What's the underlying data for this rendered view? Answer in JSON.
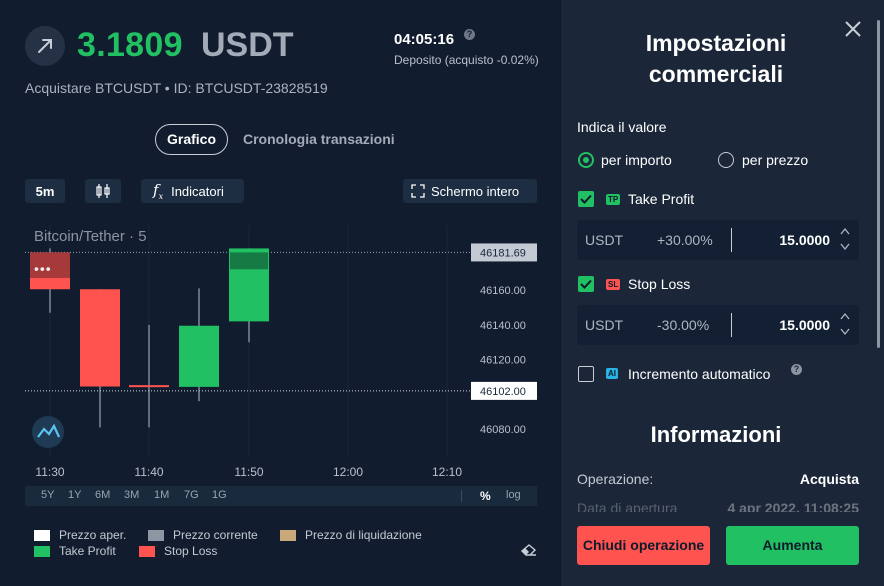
{
  "header": {
    "price": "3.1809",
    "currency": "USDT",
    "timer": "04:05:16",
    "deposit_label": "Deposito (acquisto -0.02%)",
    "subtitle": "Acquistare BTCUSDT • ID: BTCUSDT-23828519"
  },
  "tabs": {
    "chart": "Grafico",
    "history": "Cronologia transazioni"
  },
  "toolbar": {
    "interval": "5m",
    "indicators": "Indicatori",
    "fullscreen": "Schermo intero"
  },
  "chart_data": {
    "type": "candlestick",
    "title": "Bitcoin/Tether · 5",
    "x_ticks": [
      "11:30",
      "11:40",
      "11:50",
      "12:00",
      "12:10"
    ],
    "y_ticks": [
      "46160.00",
      "46140.00",
      "46120.00",
      "46080.00"
    ],
    "price_labels": {
      "upper": "46181.69",
      "current": "46102.00"
    },
    "ylim": [
      46072,
      46190
    ],
    "candles": [
      {
        "time": "11:30",
        "open": 46181.7,
        "close": 46160.5,
        "high": 46184,
        "low": 46147,
        "color": "red"
      },
      {
        "time": "11:35",
        "open": 46160.5,
        "close": 46104.5,
        "high": 46160.5,
        "low": 46081,
        "color": "red"
      },
      {
        "time": "11:40",
        "open": 46105.3,
        "close": 46104.3,
        "high": 46140,
        "low": 46081,
        "color": "red"
      },
      {
        "time": "11:45",
        "open": 46104.3,
        "close": 46139.5,
        "high": 46161,
        "low": 46096,
        "color": "green"
      },
      {
        "time": "11:50",
        "open": 46142,
        "close": 46184,
        "high": 46184,
        "low": 46130,
        "color": "green"
      }
    ],
    "timeframes": [
      "5Y",
      "1Y",
      "6M",
      "3M",
      "1M",
      "7G",
      "1G"
    ],
    "scale_options": [
      "%",
      "log"
    ]
  },
  "legend": [
    {
      "label": "Prezzo aper.",
      "color": "#ffffff"
    },
    {
      "label": "Prezzo corrente",
      "color": "#8d96a3"
    },
    {
      "label": "Prezzo di liquidazione",
      "color": "#c9a87c"
    },
    {
      "label": "Take Profit",
      "color": "#21c063"
    },
    {
      "label": "Stop Loss",
      "color": "#ff5350"
    }
  ],
  "settings": {
    "title": "Impostazioni commerciali",
    "value_label": "Indica il valore",
    "radio_amount": "per importo",
    "radio_price": "per prezzo",
    "tp_tag": "TP",
    "tp_label": "Take Profit",
    "tp_currency": "USDT",
    "tp_pct": "+30.00%",
    "tp_value": "15.0000",
    "sl_tag": "SL",
    "sl_label": "Stop Loss",
    "sl_currency": "USDT",
    "sl_pct": "-30.00%",
    "sl_value": "15.0000",
    "ai_tag": "AI",
    "auto_label": "Incremento automatico"
  },
  "info": {
    "title": "Informazioni",
    "op_label": "Operazione:",
    "op_value": "Acquista",
    "open_label": "Data di apertura",
    "open_value": "4 apr 2022, 11:08:25"
  },
  "actions": {
    "close": "Chiudi operazione",
    "increase": "Aumenta"
  }
}
